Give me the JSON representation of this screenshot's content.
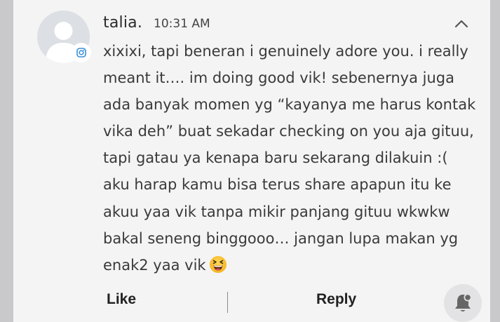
{
  "comment": {
    "author": "talia.",
    "timestamp": "10:31 AM",
    "message_lines": [
      "xixixi, tapi beneran i genuinely adore you. i really",
      "meant it…. im doing good vik! sebenernya juga",
      "ada banyak momen yg “kayanya me harus kontak",
      "vika deh” buat sekadar checking on you aja gituu,",
      "tapi gatau ya kenapa baru sekarang dilakuin :(",
      "aku harap kamu bisa terus share apapun itu ke",
      "akuu yaa vik tanpa mikir panjang gituu wkwkw",
      "bakal seneng binggooo… jangan lupa makan yg",
      "enak2 yaa vik"
    ],
    "emoji": "laughing-face-emoji"
  },
  "actions": {
    "like_label": "Like",
    "reply_label": "Reply"
  },
  "icons": {
    "avatar": "default-avatar-icon",
    "badge": "instagram-icon",
    "collapse": "chevron-up-icon",
    "notify": "bell-icon"
  },
  "colors": {
    "background": "#f4f4f5",
    "text": "#3a3a3a",
    "instagram_blue": "#3a8fd6"
  }
}
